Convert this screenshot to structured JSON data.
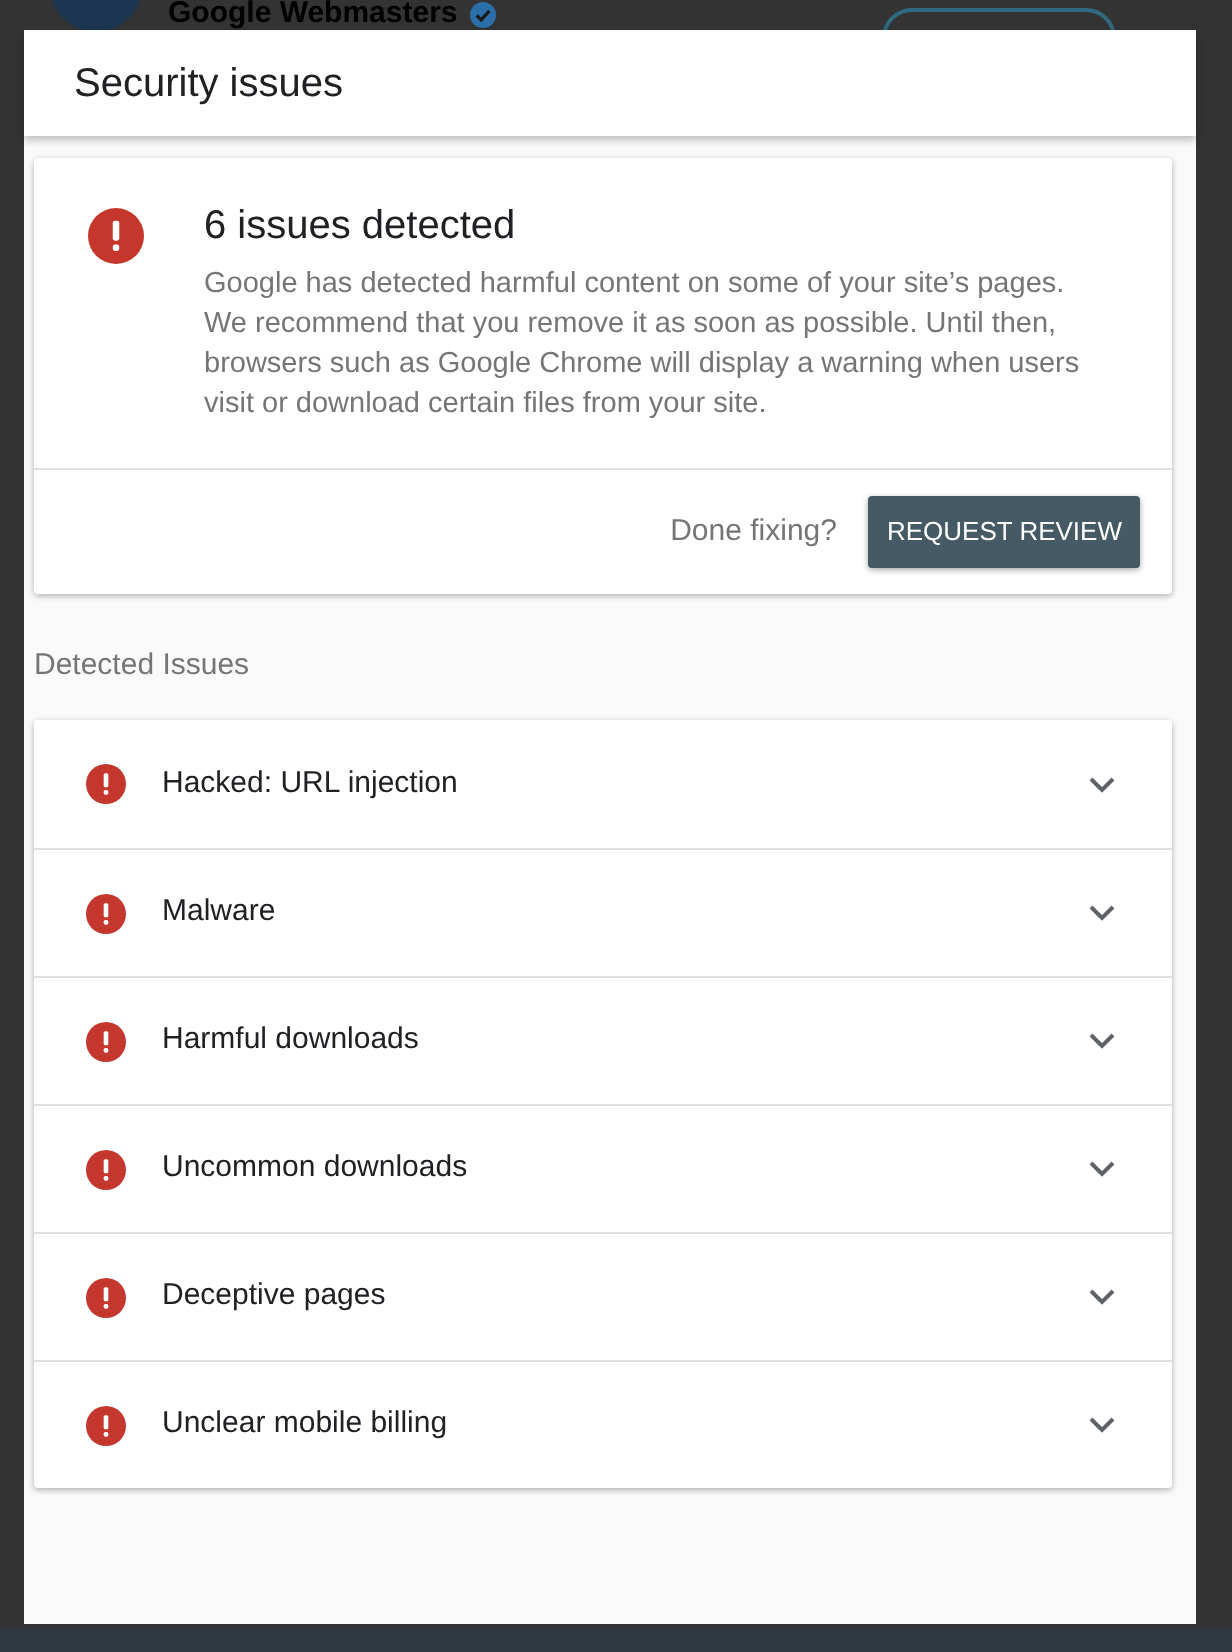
{
  "background_page": {
    "channel_name": "Google Webmasters"
  },
  "dialog": {
    "title": "Security issues"
  },
  "summary": {
    "title": "6 issues detected",
    "description": "Google has detected harmful content on some of your site’s pages. We recommend that you remove it as soon as possible. Until then, browsers such as Google Chrome will display a warning when users visit or download certain files from your site.",
    "footer_prompt": "Done fixing?",
    "action": "REQUEST REVIEW"
  },
  "issues_section": {
    "heading": "Detected Issues",
    "issues": [
      {
        "label": "Hacked: URL injection",
        "expanded": false
      },
      {
        "label": "Malware",
        "expanded": false
      },
      {
        "label": "Harmful downloads",
        "expanded": false
      },
      {
        "label": "Uncommon downloads",
        "expanded": false
      },
      {
        "label": "Deceptive pages",
        "expanded": false
      },
      {
        "label": "Unclear mobile billing",
        "expanded": false
      }
    ]
  }
}
